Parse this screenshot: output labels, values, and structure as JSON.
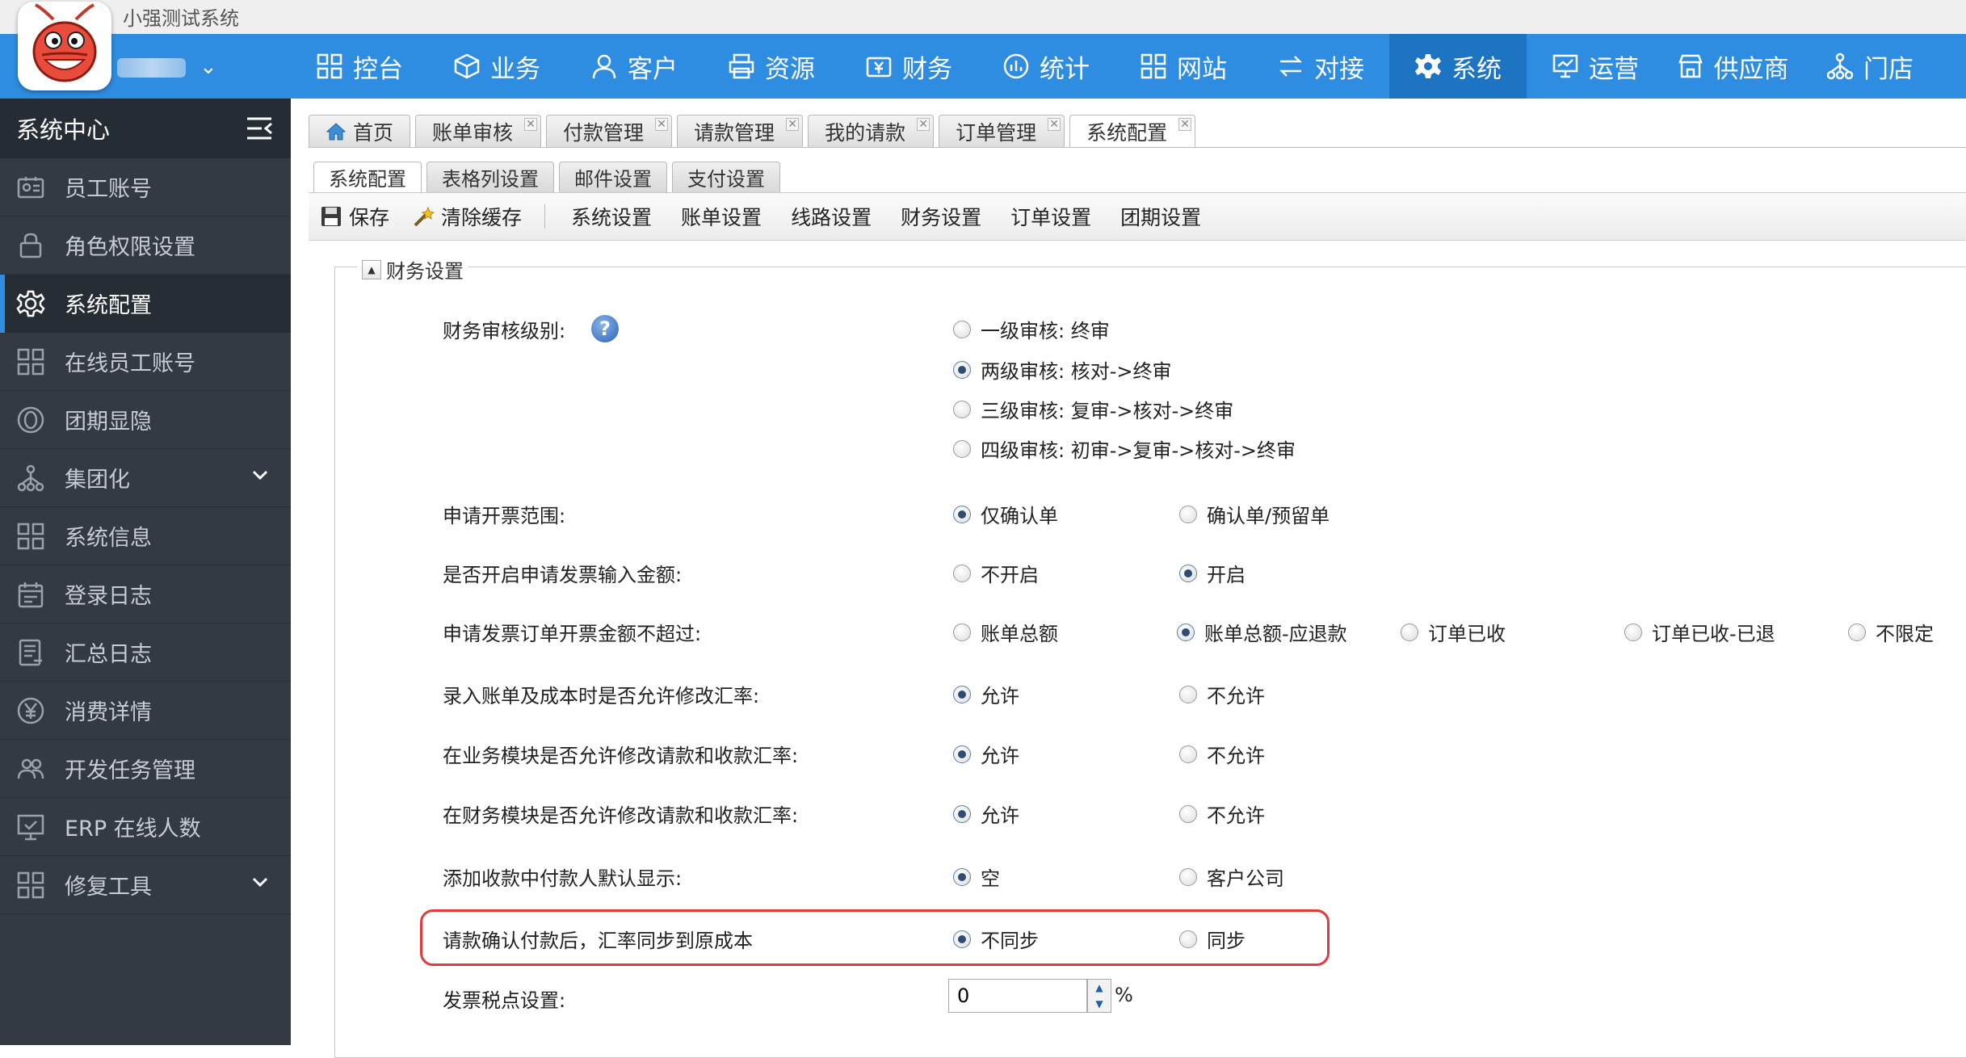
{
  "app": {
    "title": "小强测试系统"
  },
  "nav": {
    "items": [
      {
        "label": "控台"
      },
      {
        "label": "业务"
      },
      {
        "label": "客户"
      },
      {
        "label": "资源"
      },
      {
        "label": "财务"
      },
      {
        "label": "统计"
      },
      {
        "label": "网站"
      },
      {
        "label": "对接"
      },
      {
        "label": "系统"
      },
      {
        "label": "运营"
      },
      {
        "label": "供应商"
      },
      {
        "label": "门店"
      }
    ],
    "active_index": 8
  },
  "sidebar": {
    "title": "系统中心",
    "items": [
      {
        "label": "员工账号",
        "icon": "id-card-icon"
      },
      {
        "label": "角色权限设置",
        "icon": "lock-icon"
      },
      {
        "label": "系统配置",
        "icon": "gear-icon"
      },
      {
        "label": "在线员工账号",
        "icon": "grid-icon"
      },
      {
        "label": "团期显隐",
        "icon": "eye-icon"
      },
      {
        "label": "集团化",
        "icon": "org-icon"
      },
      {
        "label": "系统信息",
        "icon": "grid-icon"
      },
      {
        "label": "登录日志",
        "icon": "calendar-icon"
      },
      {
        "label": "汇总日志",
        "icon": "list-icon"
      },
      {
        "label": "消费详情",
        "icon": "yen-icon"
      },
      {
        "label": "开发任务管理",
        "icon": "users-icon"
      },
      {
        "label": "ERP 在线人数",
        "icon": "monitor-check-icon"
      },
      {
        "label": "修复工具",
        "icon": "grid-icon"
      }
    ]
  },
  "tabs": [
    {
      "label": "首页"
    },
    {
      "label": "账单审核"
    },
    {
      "label": "付款管理"
    },
    {
      "label": "请款管理"
    },
    {
      "label": "我的请款"
    },
    {
      "label": "订单管理"
    },
    {
      "label": "系统配置"
    }
  ],
  "subtabs": [
    {
      "label": "系统配置"
    },
    {
      "label": "表格列设置"
    },
    {
      "label": "邮件设置"
    },
    {
      "label": "支付设置"
    }
  ],
  "toolbar": {
    "save": "保存",
    "clear_cache": "清除缓存",
    "links": [
      "系统设置",
      "账单设置",
      "线路设置",
      "财务设置",
      "订单设置",
      "团期设置"
    ]
  },
  "section": {
    "legend": "财务设置",
    "audit_level": {
      "label": "财务审核级别:",
      "options": [
        "一级审核: 终审",
        "两级审核: 核对->终审",
        "三级审核: 复审->核对->终审",
        "四级审核: 初审->复审->核对->终审"
      ],
      "selected": 1
    },
    "invoice_scope": {
      "label": "申请开票范围:",
      "options": [
        "仅确认单",
        "确认单/预留单"
      ],
      "selected": 0
    },
    "invoice_amount_input": {
      "label": "是否开启申请发票输入金额:",
      "options": [
        "不开启",
        "开启"
      ],
      "selected": 1
    },
    "invoice_limit": {
      "label": "申请发票订单开票金额不超过:",
      "options": [
        "账单总额",
        "账单总额-应退款",
        "订单已收",
        "订单已收-已退",
        "不限定"
      ],
      "selected": 1
    },
    "rate_edit_billing": {
      "label": "录入账单及成本时是否允许修改汇率:",
      "options": [
        "允许",
        "不允许"
      ],
      "selected": 0
    },
    "rate_edit_business": {
      "label": "在业务模块是否允许修改请款和收款汇率:",
      "options": [
        "允许",
        "不允许"
      ],
      "selected": 0
    },
    "rate_edit_finance": {
      "label": "在财务模块是否允许修改请款和收款汇率:",
      "options": [
        "允许",
        "不允许"
      ],
      "selected": 0
    },
    "payer_default": {
      "label": "添加收款中付款人默认显示:",
      "options": [
        "空",
        "客户公司"
      ],
      "selected": 0
    },
    "rate_sync": {
      "label": "请款确认付款后，汇率同步到原成本",
      "options": [
        "不同步",
        "同步"
      ],
      "selected": 0
    },
    "tax_rate": {
      "label": "发票税点设置:",
      "value": "0",
      "unit": "%"
    }
  }
}
